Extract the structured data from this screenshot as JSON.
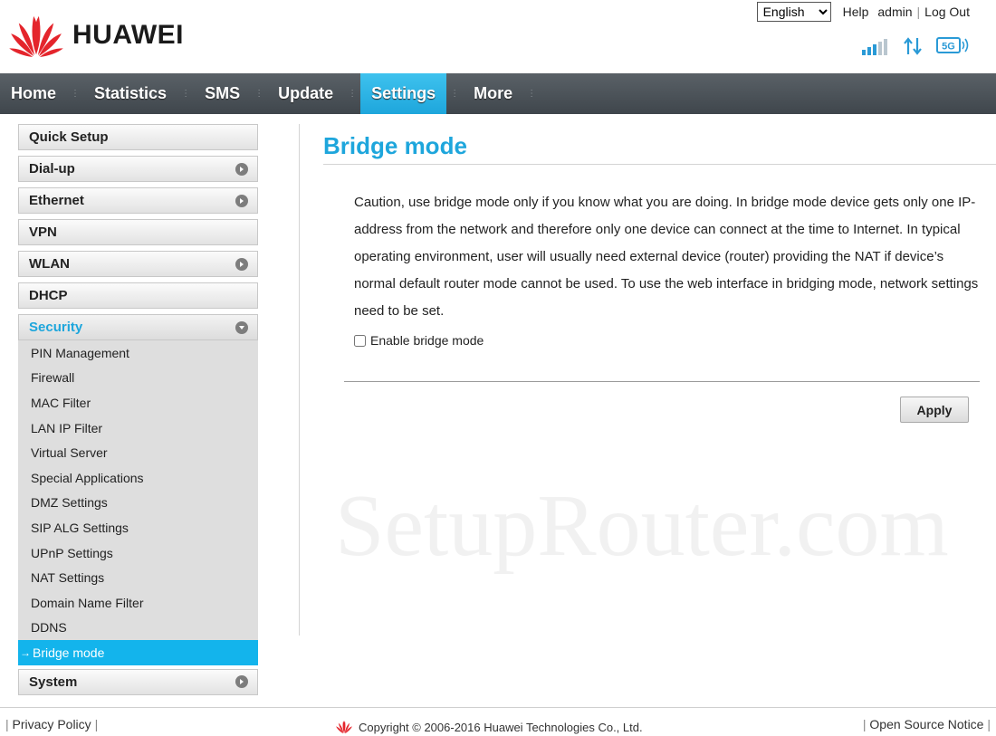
{
  "brand": {
    "name": "HUAWEI"
  },
  "top_links": {
    "language": "English",
    "language_options": [
      "English"
    ],
    "help": "Help",
    "user": "admin",
    "logout": "Log Out"
  },
  "status": {
    "network_type": "5G",
    "signal_icon": "signal-bars-icon",
    "data_icon": "up-down-arrows-icon"
  },
  "nav": {
    "items": [
      {
        "label": "Home"
      },
      {
        "label": "Statistics"
      },
      {
        "label": "SMS"
      },
      {
        "label": "Update"
      },
      {
        "label": "Settings"
      },
      {
        "label": "More"
      }
    ],
    "active": "Settings"
  },
  "sidebar": {
    "sections": [
      {
        "label": "Quick Setup"
      },
      {
        "label": "Dial-up"
      },
      {
        "label": "Ethernet"
      },
      {
        "label": "VPN"
      },
      {
        "label": "WLAN"
      },
      {
        "label": "DHCP"
      },
      {
        "label": "Security"
      },
      {
        "label": "System"
      }
    ],
    "security_items": [
      {
        "label": "PIN Management"
      },
      {
        "label": "Firewall"
      },
      {
        "label": "MAC Filter"
      },
      {
        "label": "LAN IP Filter"
      },
      {
        "label": "Virtual Server"
      },
      {
        "label": "Special Applications"
      },
      {
        "label": "DMZ Settings"
      },
      {
        "label": "SIP ALG Settings"
      },
      {
        "label": "UPnP Settings"
      },
      {
        "label": "NAT Settings"
      },
      {
        "label": "Domain Name Filter"
      },
      {
        "label": "DDNS"
      },
      {
        "label": "Bridge mode"
      }
    ],
    "active_prefix": "→"
  },
  "main": {
    "title": "Bridge mode",
    "description": "Caution, use bridge mode only if you know what you are doing. In bridge mode device gets only one IP-address from the network and therefore only one device can connect at the time to Internet. In typical operating environment, user will usually need external device (router) providing the NAT if device’s normal default router mode cannot be used. To use the web interface in bridging mode, network settings need to be set.",
    "checkbox_label": "Enable bridge mode",
    "checkbox_checked": false,
    "apply": "Apply"
  },
  "watermark": "SetupRouter.com",
  "footer": {
    "privacy": "Privacy Policy",
    "copyright": "Copyright © 2006-2016 Huawei Technologies Co., Ltd.",
    "open_source": "Open Source Notice"
  },
  "colors": {
    "accent": "#1ea6dc",
    "nav_bg": "#4a5157",
    "active_sub": "#13b4ec"
  }
}
